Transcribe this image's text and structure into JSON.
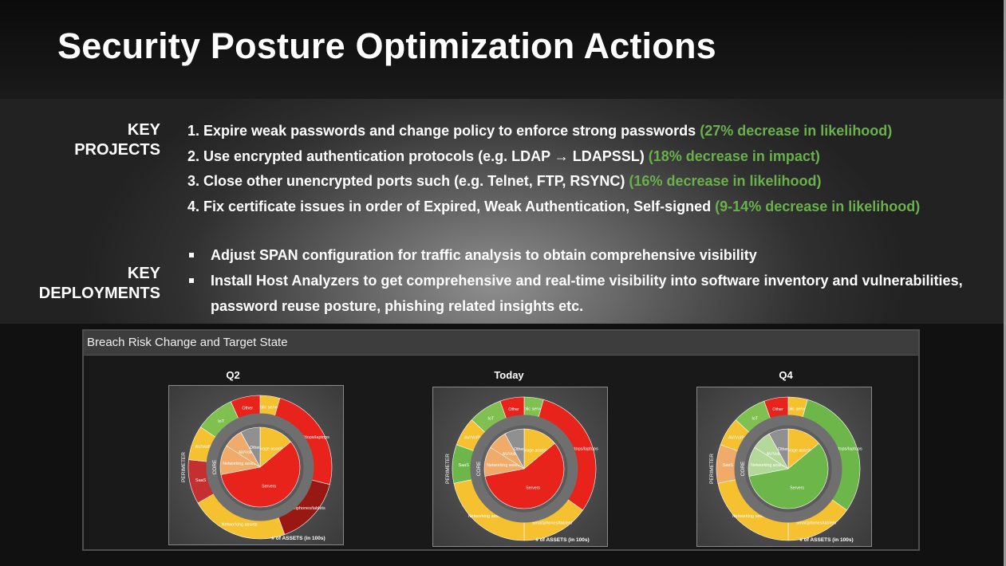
{
  "slide": {
    "title": "Security Posture Optimization Actions",
    "key_projects_label": "KEY PROJECTS",
    "key_projects_line1": "KEY",
    "key_projects_line2": "PROJECTS",
    "projects": [
      {
        "text": "1. Expire weak passwords and change policy to enforce strong passwords ",
        "impact": "(27% decrease in likelihood)"
      },
      {
        "text": "2. Use encrypted authentication protocols (e.g. LDAP → LDAPSSL) ",
        "impact": "(18% decrease in impact)"
      },
      {
        "text": "3. Close other unencrypted ports such (e.g. Telnet, FTP, RSYNC) ",
        "impact": "(16% decrease in likelihood)"
      },
      {
        "text": "4. Fix certificate issues in order of Expired, Weak Authentication, Self-signed ",
        "impact": "(9-14% decrease in likelihood)"
      }
    ],
    "key_deployments_label": "KEY DEPLOYMENTS",
    "key_deployments_line1": "KEY",
    "key_deployments_line2": "DEPLOYMENTS",
    "deployments": [
      "Adjust SPAN configuration for traffic analysis to obtain comprehensive visibility",
      "Install Host Analyzers to get comprehensive and real-time visibility into software inventory and vulnerabilities, password reuse posture, phishing related insights etc."
    ],
    "accent_green": "#6ab04c"
  },
  "panel": {
    "header": "Breach Risk Change and Target State"
  },
  "chart_data": [
    {
      "type": "pie",
      "title": "Q2",
      "inner_label": "CORE",
      "outer_label": "PERIMETER",
      "footer": "# of ASSETS (in 100s)",
      "outer_ring": [
        {
          "name": "Public servers",
          "value": 4,
          "color": "#f6c130"
        },
        {
          "name": "Desktops/laptops",
          "value": 22,
          "color": "#e8231b"
        },
        {
          "name": "Smartphones/tablets",
          "value": 14,
          "color": "#9a1813"
        },
        {
          "name": "Networking assets",
          "value": 20,
          "color": "#f6c130"
        },
        {
          "name": "SaaS",
          "value": 9,
          "color": "#c42f2f"
        },
        {
          "name": "AV/VoIP",
          "value": 7,
          "color": "#f6c130"
        },
        {
          "name": "IoT",
          "value": 8,
          "color": "#7fc050"
        },
        {
          "name": "Other",
          "value": 6,
          "color": "#e8231b"
        }
      ],
      "inner_ring": [
        {
          "name": "Storage assets",
          "value": 14,
          "color": "#f6c130"
        },
        {
          "name": "Servers",
          "value": 58,
          "color": "#e8231b"
        },
        {
          "name": "Networking assets",
          "value": 12,
          "color": "#f0aa6a"
        },
        {
          "name": "AV/VoIP",
          "value": 8,
          "color": "#f0aa6a"
        },
        {
          "name": "Other",
          "value": 8,
          "color": "#909090"
        }
      ]
    },
    {
      "type": "pie",
      "title": "Today",
      "inner_label": "CORE",
      "outer_label": "PERIMETER",
      "footer": "# of ASSETS (in 100s)",
      "outer_ring": [
        {
          "name": "Public servers",
          "value": 4,
          "color": "#7fc050"
        },
        {
          "name": "Desktops/laptops",
          "value": 28,
          "color": "#e8231b"
        },
        {
          "name": "Smartphones/tablets",
          "value": 14,
          "color": "#f6c130"
        },
        {
          "name": "Networking assets",
          "value": 20,
          "color": "#f6c130"
        },
        {
          "name": "SaaS",
          "value": 8,
          "color": "#6db64a"
        },
        {
          "name": "AV/VoIP",
          "value": 6,
          "color": "#f6c130"
        },
        {
          "name": "IoT",
          "value": 7,
          "color": "#7fc050"
        },
        {
          "name": "Other",
          "value": 5,
          "color": "#e8231b"
        }
      ],
      "inner_ring": [
        {
          "name": "Storage assets",
          "value": 14,
          "color": "#f6c130"
        },
        {
          "name": "Servers",
          "value": 58,
          "color": "#e8231b"
        },
        {
          "name": "Networking assets",
          "value": 12,
          "color": "#f0aa6a"
        },
        {
          "name": "AV/VoIP",
          "value": 8,
          "color": "#f0aa6a"
        },
        {
          "name": "Other",
          "value": 8,
          "color": "#909090"
        }
      ]
    },
    {
      "type": "pie",
      "title": "Q4",
      "inner_label": "CORE",
      "outer_label": "PERIMETER",
      "footer": "# of ASSETS (in 100s)",
      "outer_ring": [
        {
          "name": "Public servers",
          "value": 4,
          "color": "#f6c130"
        },
        {
          "name": "Desktops/laptops",
          "value": 28,
          "color": "#6db64a"
        },
        {
          "name": "Smartphones/tablets",
          "value": 14,
          "color": "#f6c130"
        },
        {
          "name": "Networking assets",
          "value": 20,
          "color": "#f6c130"
        },
        {
          "name": "SaaS",
          "value": 8,
          "color": "#f0aa6a"
        },
        {
          "name": "AV/VoIP",
          "value": 6,
          "color": "#f6c130"
        },
        {
          "name": "IoT",
          "value": 7,
          "color": "#7fc050"
        },
        {
          "name": "Other",
          "value": 5,
          "color": "#e8231b"
        }
      ],
      "inner_ring": [
        {
          "name": "Storage assets",
          "value": 14,
          "color": "#f6c130"
        },
        {
          "name": "Servers",
          "value": 58,
          "color": "#6db64a"
        },
        {
          "name": "Networking assets",
          "value": 12,
          "color": "#b4d79a"
        },
        {
          "name": "AV/VoIP",
          "value": 8,
          "color": "#b4d79a"
        },
        {
          "name": "Other",
          "value": 8,
          "color": "#909090"
        }
      ]
    }
  ]
}
